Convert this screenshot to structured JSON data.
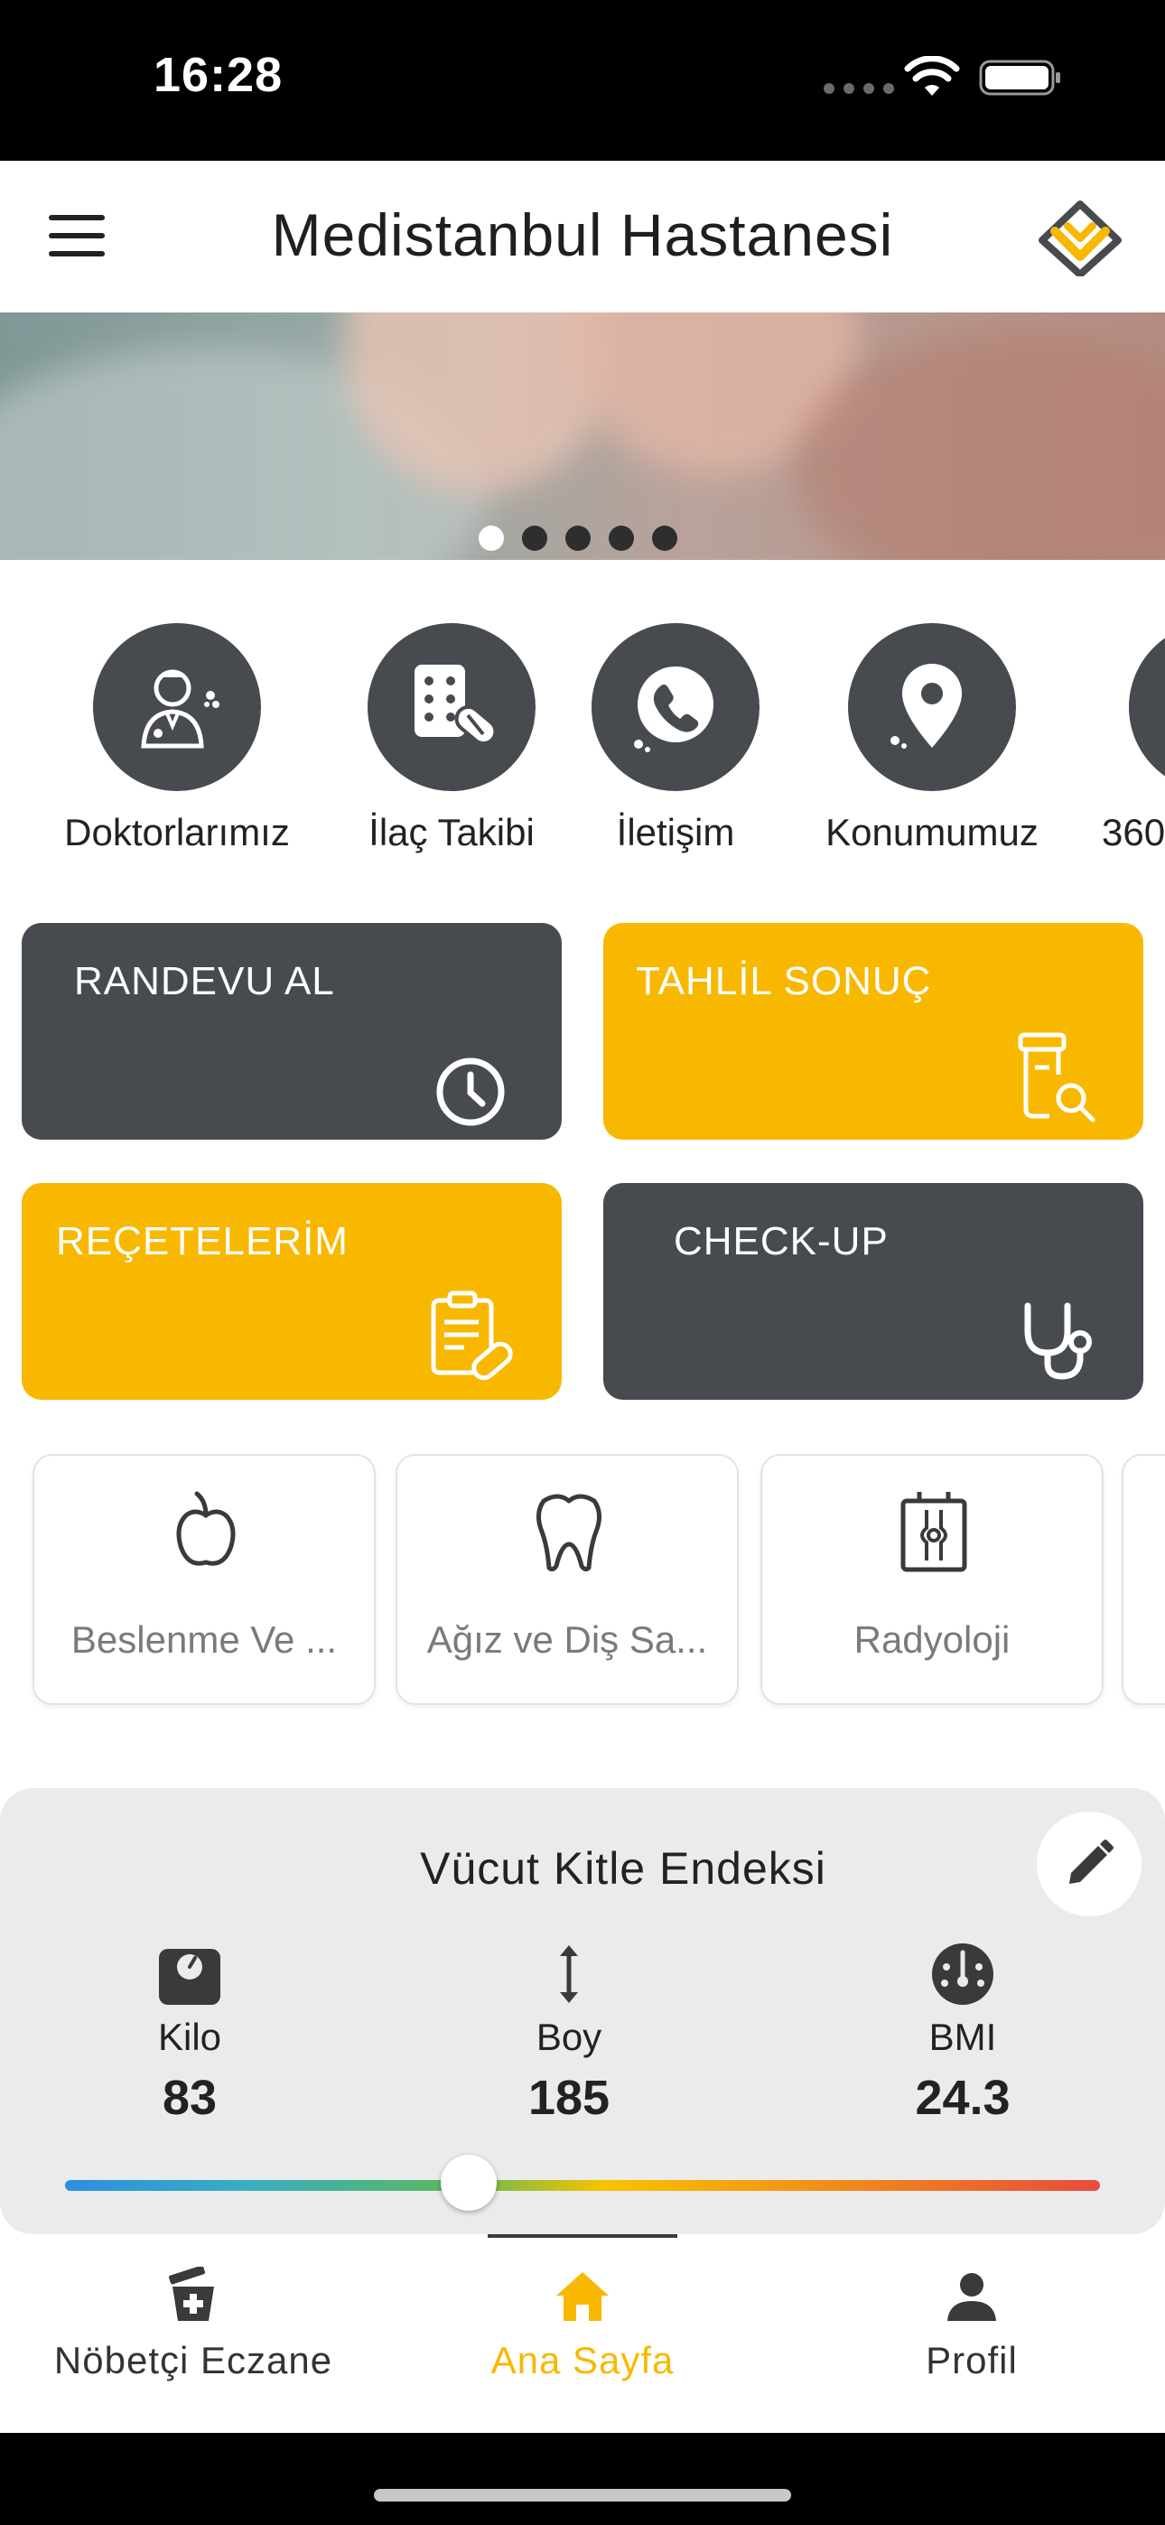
{
  "status_bar": {
    "time": "16:28"
  },
  "header": {
    "title": "Medistanbul Hastanesi"
  },
  "banner": {
    "dot_count": 5,
    "active_dot": 0
  },
  "quick_actions": [
    {
      "label": "Doktorlarımız",
      "icon": "doctor-icon"
    },
    {
      "label": "İlaç Takibi",
      "icon": "pill-icon"
    },
    {
      "label": "İletişim",
      "icon": "phone-icon"
    },
    {
      "label": "Konumumuz",
      "icon": "location-pin-icon"
    },
    {
      "label": "360",
      "icon": "360-icon"
    }
  ],
  "cards": [
    {
      "title": "RANDEVU AL",
      "icon": "clock-icon",
      "color": "#474b50"
    },
    {
      "title": "TAHLİL SONUÇ",
      "icon": "test-tube-search-icon",
      "color": "#f8b800"
    },
    {
      "title": "REÇETELERİM",
      "icon": "prescription-icon",
      "color": "#f8b800"
    },
    {
      "title": "CHECK-UP",
      "icon": "stethoscope-icon",
      "color": "#474b50"
    }
  ],
  "departments": [
    {
      "label": "Beslenme Ve ...",
      "icon": "apple-icon"
    },
    {
      "label": "Ağız ve Diş Sa...",
      "icon": "tooth-icon"
    },
    {
      "label": "Radyoloji",
      "icon": "xray-icon"
    }
  ],
  "bmi": {
    "title": "Vücut Kitle Endeksi",
    "kilo_label": "Kilo",
    "kilo_value": "83",
    "boy_label": "Boy",
    "boy_value": "185",
    "bmi_label": "BMI",
    "bmi_value": "24.3",
    "slider_fraction": 0.39
  },
  "bottom_nav": [
    {
      "label": "Nöbetçi Eczane",
      "icon": "pharmacy-icon",
      "active": false
    },
    {
      "label": "Ana Sayfa",
      "icon": "home-icon",
      "active": true
    },
    {
      "label": "Profil",
      "icon": "person-icon",
      "active": false
    }
  ],
  "colors": {
    "accent": "#f8b800",
    "dark": "#474b50",
    "background": "#ffffff"
  }
}
